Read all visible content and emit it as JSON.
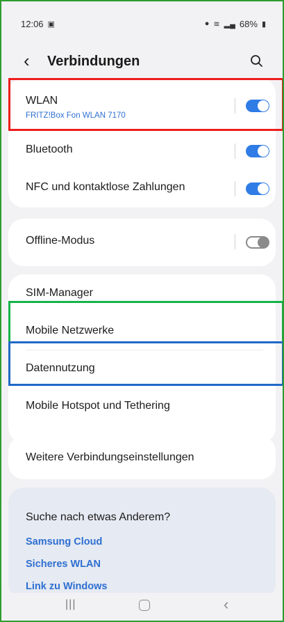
{
  "status_bar": {
    "time": "12:06",
    "battery": "68%"
  },
  "header": {
    "title": "Verbindungen"
  },
  "group1": {
    "wlan": {
      "label": "WLAN",
      "network": "FRITZ!Box Fon WLAN 7170",
      "enabled": true
    },
    "bluetooth": {
      "label": "Bluetooth",
      "enabled": true
    },
    "nfc": {
      "label": "NFC und kontaktlose Zahlungen",
      "enabled": true
    }
  },
  "group2": {
    "offline": {
      "label": "Offline-Modus",
      "enabled": false
    }
  },
  "group3": {
    "items": [
      {
        "label": "SIM-Manager"
      },
      {
        "label": "Mobile Netzwerke"
      },
      {
        "label": "Datennutzung"
      },
      {
        "label": "Mobile Hotspot und Tethering"
      }
    ]
  },
  "group4": {
    "label": "Weitere Verbindungseinstellungen"
  },
  "suggestions": {
    "heading": "Suche nach etwas Anderem?",
    "links": [
      "Samsung Cloud",
      "Sicheres WLAN",
      "Link zu Windows"
    ]
  },
  "colors": {
    "accent": "#2f7ce6",
    "highlight_red": "#ee1c1c",
    "highlight_green": "#15b34a",
    "highlight_blue": "#1f69c6"
  }
}
